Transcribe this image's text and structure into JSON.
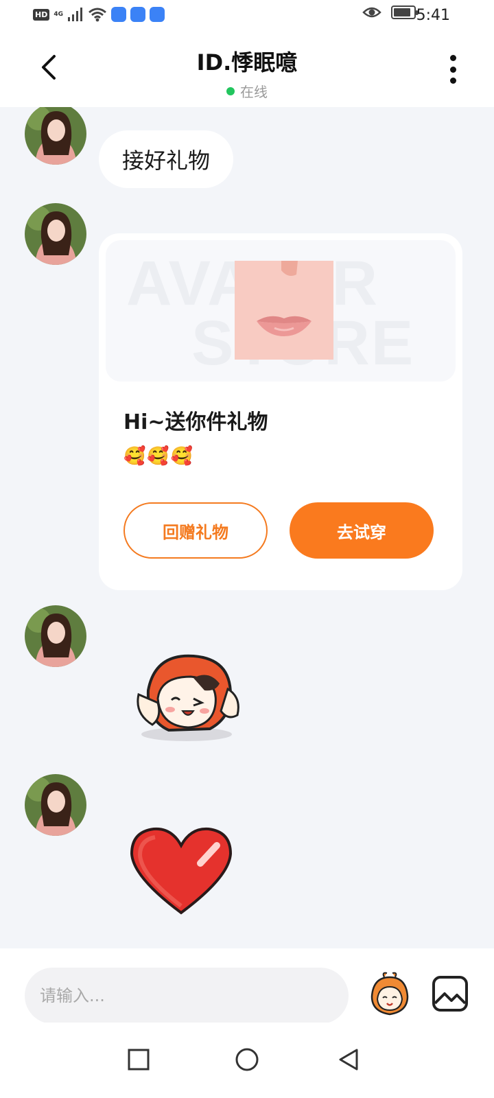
{
  "status_bar": {
    "hd_badge": "HD",
    "network": "4G",
    "time": "5:41",
    "battery_level": 0.85
  },
  "header": {
    "title": "ID.悸眠噫",
    "status": "在线"
  },
  "messages": {
    "text_message": "接好礼物",
    "gift_card": {
      "title": "Hi~送你件礼物",
      "emojis": "🥰🥰🥰",
      "return_gift_label": "回赠礼物",
      "try_on_label": "去试穿",
      "watermark_line1": "AVATAR",
      "watermark_line2": "STORE"
    }
  },
  "input": {
    "placeholder": "请输入..."
  },
  "colors": {
    "accent": "#fa7a1e",
    "online": "#22c55e",
    "background": "#f3f5f9"
  }
}
